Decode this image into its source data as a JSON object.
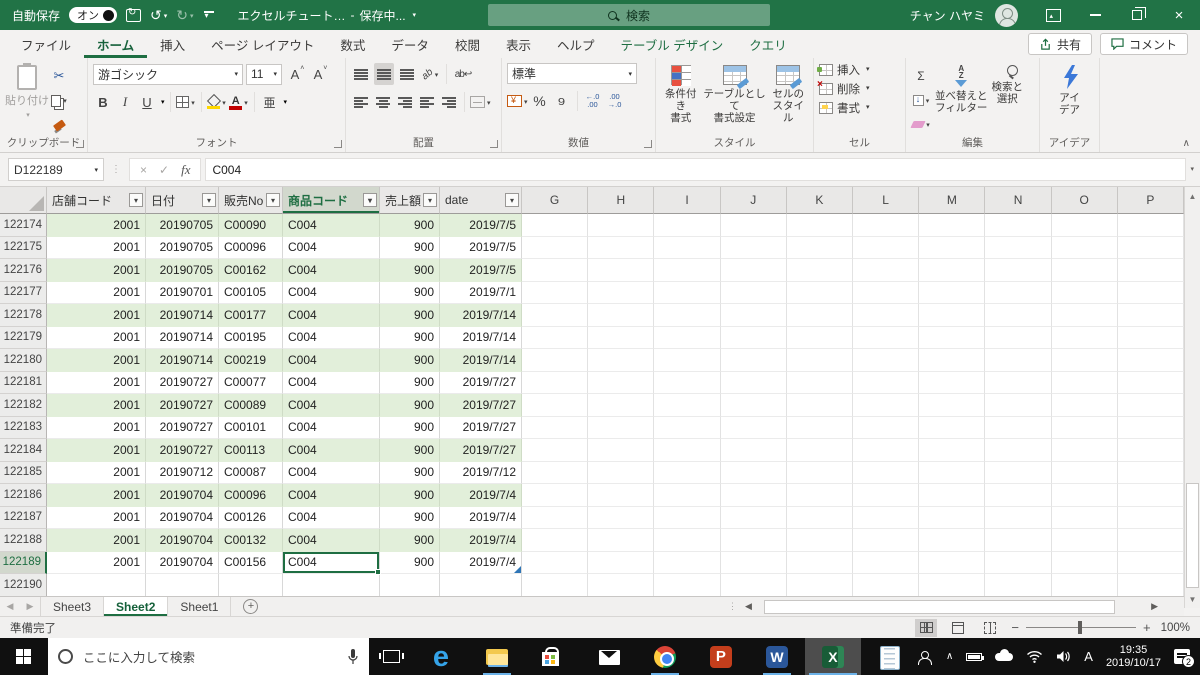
{
  "colors": {
    "titlebar_green": "#217346",
    "accent_green": "#1e6e42",
    "band_green": "#e2efda",
    "selection_green": "#1e6e42",
    "taskbar_black": "#101010",
    "running_indicator": "#6cb2e8"
  },
  "titlebar": {
    "autosave_label": "自動保存",
    "autosave_state": "オン",
    "filename": "エクセルチュート…",
    "separator": "-",
    "saving_status": "保存中...",
    "search_placeholder": "検索",
    "user_name": "チャン ハヤミ"
  },
  "ribbon_tabs": {
    "items": [
      {
        "label": "ファイル",
        "state": "normal"
      },
      {
        "label": "ホーム",
        "state": "active"
      },
      {
        "label": "挿入",
        "state": "normal"
      },
      {
        "label": "ページ レイアウト",
        "state": "normal"
      },
      {
        "label": "数式",
        "state": "normal"
      },
      {
        "label": "データ",
        "state": "normal"
      },
      {
        "label": "校閲",
        "state": "normal"
      },
      {
        "label": "表示",
        "state": "normal"
      },
      {
        "label": "ヘルプ",
        "state": "normal"
      },
      {
        "label": "テーブル デザイン",
        "state": "contextual"
      },
      {
        "label": "クエリ",
        "state": "contextual"
      }
    ],
    "share_label": "共有",
    "comments_label": "コメント"
  },
  "ribbon": {
    "clipboard": {
      "group_label": "クリップボード",
      "paste_label": "貼り付け"
    },
    "font": {
      "group_label": "フォント",
      "font_name": "游ゴシック",
      "font_size": "11"
    },
    "alignment": {
      "group_label": "配置"
    },
    "number": {
      "group_label": "数値",
      "format": "標準"
    },
    "styles": {
      "group_label": "スタイル",
      "buttons": [
        {
          "label": "条件付き\n書式"
        },
        {
          "label": "テーブルとして\n書式設定"
        },
        {
          "label": "セルの\nスタイル"
        }
      ]
    },
    "cells": {
      "group_label": "セル",
      "buttons": [
        {
          "label": "挿入"
        },
        {
          "label": "削除"
        },
        {
          "label": "書式"
        }
      ]
    },
    "editing": {
      "group_label": "編集",
      "buttons": [
        {
          "label": "並べ替えと\nフィルター"
        },
        {
          "label": "検索と\n選択"
        }
      ]
    },
    "ideas": {
      "group_label": "アイデア",
      "button_label": "アイ\nデア"
    }
  },
  "formula_bar": {
    "name_box": "D122189",
    "formula": "C004"
  },
  "grid": {
    "table_headers": [
      "店舗コード",
      "日付",
      "販売No",
      "商品コード",
      "売上額",
      "date"
    ],
    "selected_header_index": 3,
    "letter_columns": [
      "G",
      "H",
      "I",
      "J",
      "K",
      "L",
      "M",
      "N",
      "O",
      "P"
    ],
    "selection": {
      "row": "122189",
      "col": 3
    },
    "rows": [
      {
        "n": "122174",
        "cells": [
          "2001",
          "20190705",
          "C00090",
          "C004",
          "900",
          "2019/7/5"
        ]
      },
      {
        "n": "122175",
        "cells": [
          "2001",
          "20190705",
          "C00096",
          "C004",
          "900",
          "2019/7/5"
        ]
      },
      {
        "n": "122176",
        "cells": [
          "2001",
          "20190705",
          "C00162",
          "C004",
          "900",
          "2019/7/5"
        ]
      },
      {
        "n": "122177",
        "cells": [
          "2001",
          "20190701",
          "C00105",
          "C004",
          "900",
          "2019/7/1"
        ]
      },
      {
        "n": "122178",
        "cells": [
          "2001",
          "20190714",
          "C00177",
          "C004",
          "900",
          "2019/7/14"
        ]
      },
      {
        "n": "122179",
        "cells": [
          "2001",
          "20190714",
          "C00195",
          "C004",
          "900",
          "2019/7/14"
        ]
      },
      {
        "n": "122180",
        "cells": [
          "2001",
          "20190714",
          "C00219",
          "C004",
          "900",
          "2019/7/14"
        ]
      },
      {
        "n": "122181",
        "cells": [
          "2001",
          "20190727",
          "C00077",
          "C004",
          "900",
          "2019/7/27"
        ]
      },
      {
        "n": "122182",
        "cells": [
          "2001",
          "20190727",
          "C00089",
          "C004",
          "900",
          "2019/7/27"
        ]
      },
      {
        "n": "122183",
        "cells": [
          "2001",
          "20190727",
          "C00101",
          "C004",
          "900",
          "2019/7/27"
        ]
      },
      {
        "n": "122184",
        "cells": [
          "2001",
          "20190727",
          "C00113",
          "C004",
          "900",
          "2019/7/27"
        ]
      },
      {
        "n": "122185",
        "cells": [
          "2001",
          "20190712",
          "C00087",
          "C004",
          "900",
          "2019/7/12"
        ]
      },
      {
        "n": "122186",
        "cells": [
          "2001",
          "20190704",
          "C00096",
          "C004",
          "900",
          "2019/7/4"
        ]
      },
      {
        "n": "122187",
        "cells": [
          "2001",
          "20190704",
          "C00126",
          "C004",
          "900",
          "2019/7/4"
        ]
      },
      {
        "n": "122188",
        "cells": [
          "2001",
          "20190704",
          "C00132",
          "C004",
          "900",
          "2019/7/4"
        ]
      },
      {
        "n": "122189",
        "cells": [
          "2001",
          "20190704",
          "C00156",
          "C004",
          "900",
          "2019/7/4"
        ]
      },
      {
        "n": "122190",
        "cells": [
          "",
          "",
          "",
          "",
          "",
          ""
        ]
      }
    ]
  },
  "sheets": {
    "items": [
      {
        "label": "Sheet3",
        "active": false
      },
      {
        "label": "Sheet2",
        "active": true
      },
      {
        "label": "Sheet1",
        "active": false
      }
    ]
  },
  "status_bar": {
    "ready": "準備完了",
    "zoom": "100%"
  },
  "taskbar": {
    "search_placeholder": "ここに入力して検索",
    "clock_time": "19:35",
    "clock_date": "2019/10/17",
    "notification_count": "2",
    "apps": [
      {
        "name": "edge"
      },
      {
        "name": "file-explorer"
      },
      {
        "name": "store"
      },
      {
        "name": "mail"
      },
      {
        "name": "chrome"
      },
      {
        "name": "powerpoint"
      },
      {
        "name": "word"
      },
      {
        "name": "excel"
      },
      {
        "name": "notepad"
      }
    ],
    "running": [
      "file-explorer",
      "chrome",
      "word",
      "excel"
    ],
    "active": "excel"
  }
}
